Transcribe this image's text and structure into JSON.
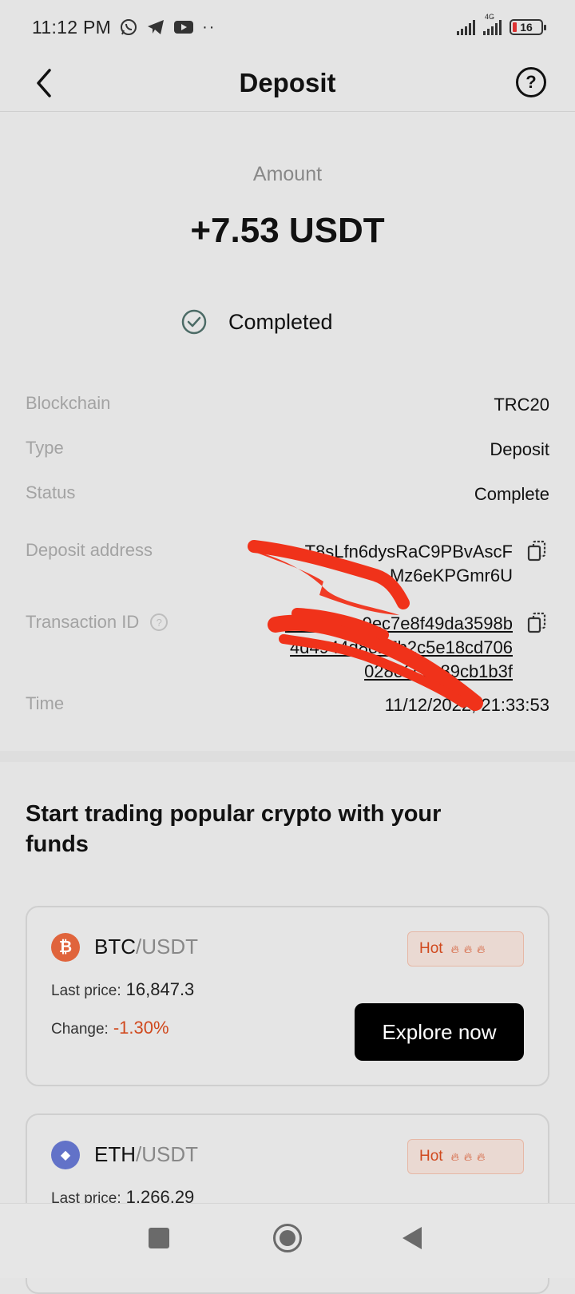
{
  "status_bar": {
    "time": "11:12 PM",
    "network": "4G",
    "battery": "16"
  },
  "header": {
    "title": "Deposit",
    "help_glyph": "?"
  },
  "summary": {
    "amount_label": "Amount",
    "amount_value": "+7.53 USDT",
    "status": "Completed"
  },
  "details": {
    "blockchain_label": "Blockchain",
    "blockchain_value": "TRC20",
    "type_label": "Type",
    "type_value": "Deposit",
    "status_label": "Status",
    "status_value": "Complete",
    "address_label": "Deposit address",
    "address_line1": "T8sLfn6dysRaC9PBvAscF",
    "address_line2": "Mz6eKPGmr6U",
    "txid_label": "Transaction ID",
    "txid_line1": "48d4989c9ec7e8f49da3598b",
    "txid_line2": "4d4944d8e27b2c5e18cd706",
    "txid_line3": "028e6c6c89cb1b3f",
    "time_label": "Time",
    "time_value": "11/12/2022, 21:33:53"
  },
  "promo": {
    "title": "Start trading popular crypto with your funds",
    "cards": [
      {
        "base": "BTC",
        "quote": "/USDT",
        "coin_glyph": "₿",
        "coin_color": "#e0643c",
        "hot_label": "Hot",
        "last_price_label": "Last price:",
        "last_price": "16,847.3",
        "change_label": "Change:",
        "change": "-1.30%",
        "button": "Explore now"
      },
      {
        "base": "ETH",
        "quote": "/USDT",
        "coin_glyph": "◆",
        "coin_color": "#6272c8",
        "hot_label": "Hot",
        "last_price_label": "Last price:",
        "last_price": "1,266.29"
      }
    ]
  },
  "colors": {
    "accent_negative": "#d0491e",
    "scribble": "#f0321a"
  }
}
